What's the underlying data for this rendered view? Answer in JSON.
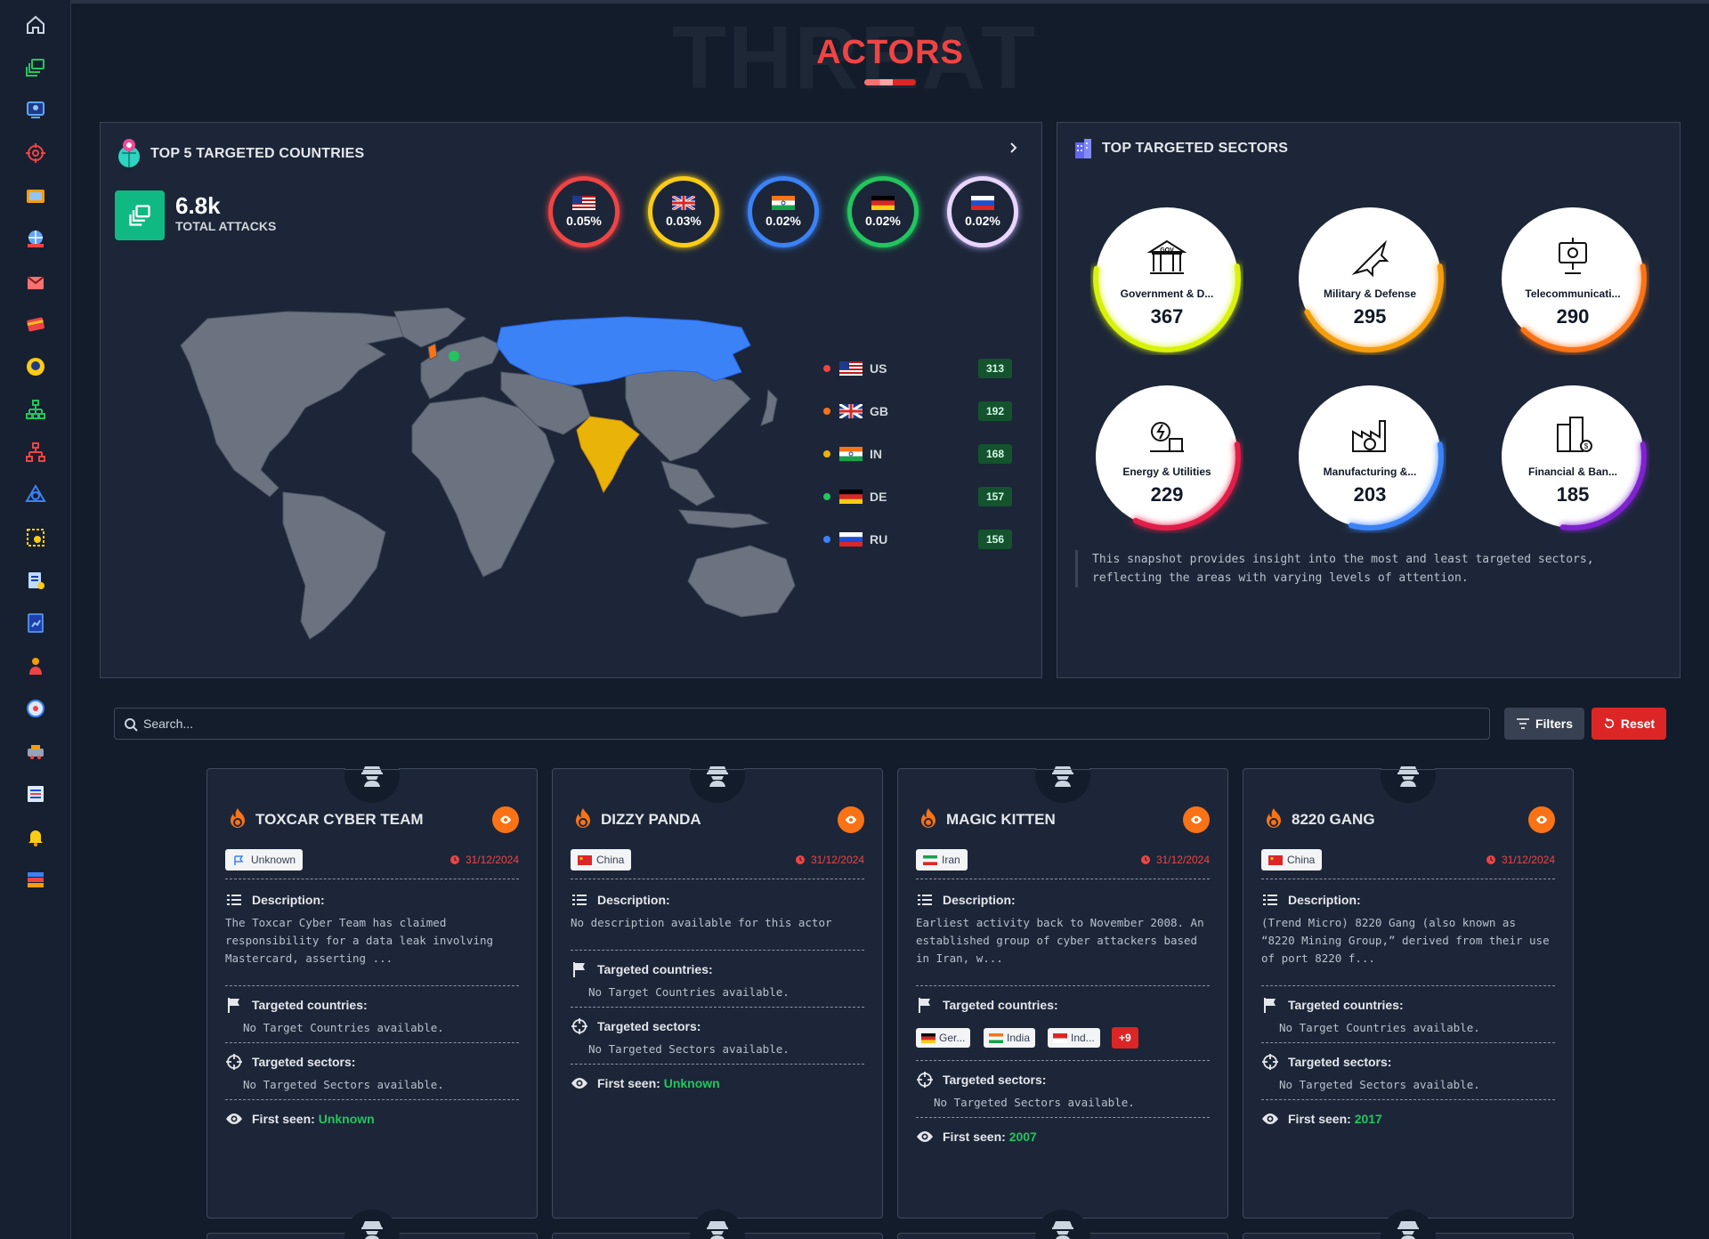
{
  "header": {
    "title": "ACTORS",
    "background_text": "THREAT"
  },
  "sidebar": {
    "items": [
      "home-icon",
      "dashboard-icon",
      "monitor-icon",
      "target-icon",
      "folder-icon",
      "globe-icon",
      "mail-icon",
      "credit-card-icon",
      "badge-icon",
      "hierarchy-icon",
      "network-icon",
      "shapes-icon",
      "settings-icon",
      "clipboard-icon",
      "report-icon",
      "user-icon",
      "world-icon",
      "vehicle-icon",
      "list-icon",
      "bell-icon",
      "stack-icon"
    ]
  },
  "countries_panel": {
    "title": "TOP 5 TARGETED COUNTRIES",
    "total_value": "6.8k",
    "total_label": "TOTAL ATTACKS",
    "rings": [
      {
        "code": "US",
        "pct": "0.05%",
        "color": "#ef4444"
      },
      {
        "code": "GB",
        "pct": "0.03%",
        "color": "#facc15"
      },
      {
        "code": "IN",
        "pct": "0.02%",
        "color": "#3b82f6"
      },
      {
        "code": "DE",
        "pct": "0.02%",
        "color": "#22c55e"
      },
      {
        "code": "RU",
        "pct": "0.02%",
        "color": "#e9d5ff"
      }
    ],
    "legend": [
      {
        "code": "US",
        "count": "313",
        "color": "#ef4444"
      },
      {
        "code": "GB",
        "count": "192",
        "color": "#f97316"
      },
      {
        "code": "IN",
        "count": "168",
        "color": "#eab308"
      },
      {
        "code": "DE",
        "count": "157",
        "color": "#22c55e"
      },
      {
        "code": "RU",
        "count": "156",
        "color": "#3b82f6"
      }
    ]
  },
  "sectors_panel": {
    "title": "TOP TARGETED SECTORS",
    "sectors": [
      {
        "name": "Government & D...",
        "value": "367",
        "color": "#d9f20a",
        "fill": 0.55
      },
      {
        "name": "Military & Defense",
        "value": "295",
        "color": "#f59e0b",
        "fill": 0.45
      },
      {
        "name": "Telecommunicati...",
        "value": "290",
        "color": "#f97316",
        "fill": 0.4
      },
      {
        "name": "Energy & Utilities",
        "value": "229",
        "color": "#e11d48",
        "fill": 0.35
      },
      {
        "name": "Manufacturing &...",
        "value": "203",
        "color": "#3b82f6",
        "fill": 0.32
      },
      {
        "name": "Financial & Ban...",
        "value": "185",
        "color": "#7e22ce",
        "fill": 0.3
      }
    ],
    "note": "This snapshot provides insight into the most and least targeted sectors, reflecting the areas with varying levels of attention."
  },
  "search": {
    "placeholder": "Search..."
  },
  "buttons": {
    "filters": "Filters",
    "reset": "Reset"
  },
  "labels": {
    "description": "Description:",
    "targeted_countries": "Targeted countries:",
    "targeted_sectors": "Targeted sectors:",
    "first_seen": "First seen:",
    "no_countries": "No Target Countries available.",
    "no_sectors": "No Targeted Sectors available."
  },
  "cards": [
    {
      "name": "TOXCAR CYBER TEAM",
      "country": "Unknown",
      "date": "31/12/2024",
      "description": "The Toxcar Cyber Team has claimed responsibility for a data leak involving Mastercard, asserting ...",
      "first_seen": "Unknown"
    },
    {
      "name": "DIZZY PANDA",
      "country": "China",
      "date": "31/12/2024",
      "description": "No description available for this actor",
      "first_seen": "Unknown"
    },
    {
      "name": "MAGIC KITTEN",
      "country": "Iran",
      "date": "31/12/2024",
      "description": "Earliest activity back to November 2008. An established group of cyber attackers based in Iran, w...",
      "targeted": [
        "Ger...",
        "India",
        "Ind..."
      ],
      "more": "+9",
      "first_seen": "2007"
    },
    {
      "name": "8220 GANG",
      "country": "China",
      "date": "31/12/2024",
      "description": "(Trend Micro) 8220 Gang (also known as “8220 Mining Group,” derived from their use of port 8220 f...",
      "first_seen": "2017"
    }
  ]
}
